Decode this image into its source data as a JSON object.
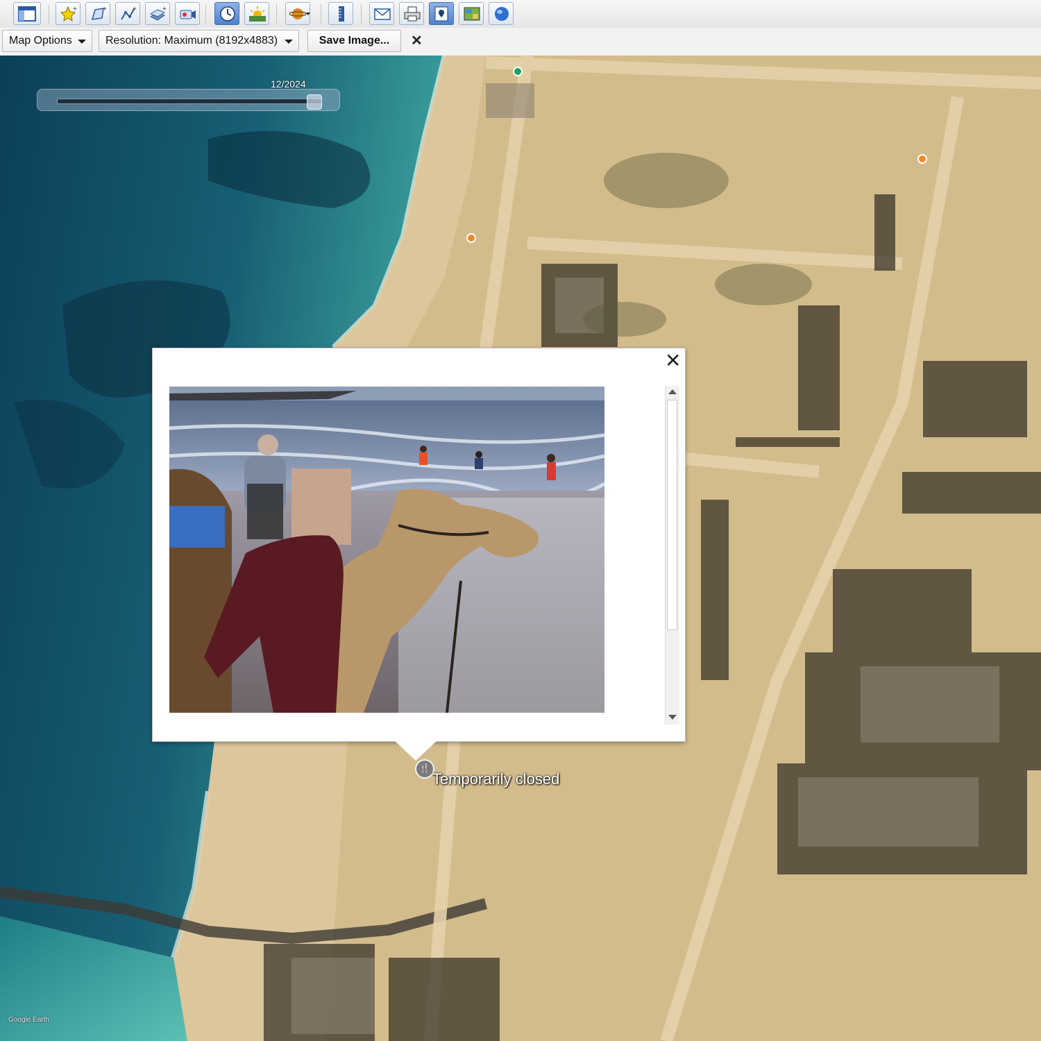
{
  "toolbar": {
    "buttons": [
      {
        "icon": "sidebar-toggle-icon"
      },
      {
        "icon": "add-placemark-icon"
      },
      {
        "icon": "add-polygon-icon"
      },
      {
        "icon": "add-path-icon"
      },
      {
        "icon": "image-overlay-icon"
      },
      {
        "icon": "record-tour-icon"
      },
      {
        "icon": "historical-imagery-icon",
        "active": true
      },
      {
        "icon": "sunlight-icon"
      },
      {
        "icon": "planets-icon"
      },
      {
        "icon": "ruler-icon"
      },
      {
        "icon": "email-icon"
      },
      {
        "icon": "print-icon"
      },
      {
        "icon": "save-image-icon",
        "active": true
      },
      {
        "icon": "view-in-maps-icon"
      },
      {
        "icon": "earth-icon"
      }
    ]
  },
  "options_bar": {
    "map_options_label": "Map Options",
    "resolution_label": "Resolution: Maximum (8192x4883)",
    "save_image_label": "Save Image...",
    "close_symbol": "✕"
  },
  "time_slider": {
    "date_label": "12/2024",
    "position_fraction": 1.0
  },
  "popup": {
    "close_symbol": "✕",
    "photo_icon": "beach-camel-photo"
  },
  "place": {
    "icon": "restaurant-icon",
    "label": "Temporarily closed"
  },
  "watermark": "Google Earth",
  "colors": {
    "sea_deep": "#0f4d68",
    "sea_shallow": "#3fa6a0",
    "sand": "#d9c394",
    "accent_blue": "#4f82cc"
  }
}
